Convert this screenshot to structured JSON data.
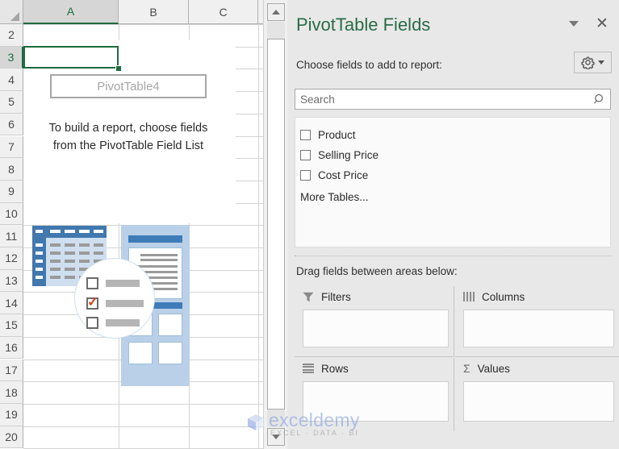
{
  "sheet": {
    "columns": [
      "A",
      "B",
      "C"
    ],
    "rows": [
      "2",
      "3",
      "4",
      "5",
      "6",
      "7",
      "8",
      "9",
      "10",
      "11",
      "12",
      "13",
      "14",
      "15",
      "16",
      "17",
      "18",
      "19",
      "20"
    ],
    "active_cell": "A3",
    "pivot_placeholder": "PivotTable4",
    "empty_message_line1": "To build a report, choose fields",
    "empty_message_line2": "from the PivotTable Field List",
    "selection_color": "#1e6b41"
  },
  "scrollbar": {
    "up_arrow": "scroll-up-arrow",
    "down_arrow": "scroll-down-arrow"
  },
  "panel": {
    "title": "PivotTable Fields",
    "title_color": "#2a6b46",
    "collapse_icon": "chevron-down-icon",
    "close_icon": "close-icon",
    "choose_label": "Choose fields to add to report:",
    "tools_icon": "gear-icon",
    "search": {
      "placeholder": "Search",
      "value": "",
      "icon": "search-icon"
    },
    "fields": [
      {
        "label": "Product",
        "checked": false
      },
      {
        "label": "Selling Price",
        "checked": false
      },
      {
        "label": "Cost Price",
        "checked": false
      }
    ],
    "more_tables": "More Tables...",
    "drag_label": "Drag fields between areas below:",
    "zones": [
      {
        "label": "Filters",
        "icon": "filter-funnel-icon",
        "items": []
      },
      {
        "label": "Columns",
        "icon": "columns-icon",
        "items": []
      },
      {
        "label": "Rows",
        "icon": "rows-icon",
        "items": []
      },
      {
        "label": "Values",
        "icon": "sigma-icon",
        "items": []
      }
    ]
  },
  "watermark": {
    "brand": "exceldemy",
    "tagline": "EXCEL · DATA · BI"
  }
}
